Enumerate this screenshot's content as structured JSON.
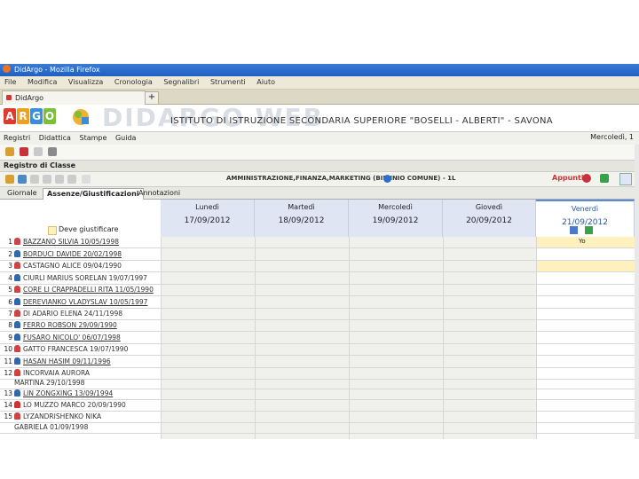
{
  "window": {
    "title": "DidArgo - Mozilla Firefox"
  },
  "menubar": [
    "File",
    "Modifica",
    "Visualizza",
    "Cronologia",
    "Segnalibri",
    "Strumenti",
    "Aiuto"
  ],
  "browser_tab": {
    "label": "DidArgo",
    "new_tab": "+"
  },
  "header": {
    "logo_letters": [
      "A",
      "R",
      "G",
      "O"
    ],
    "logo_colors": [
      "#e03a2f",
      "#f0a020",
      "#3a8fd6",
      "#7bbf3a"
    ],
    "watermark": "DIDARGO WEB",
    "school": "ISTITUTO DI ISTRUZIONE SECONDARIA SUPERIORE \"BOSELLI - ALBERTI\" - SAVONA"
  },
  "main_menu": {
    "items": [
      "Registri",
      "Didattica",
      "Stampe",
      "Guida"
    ],
    "date": "Mercoledì, 1"
  },
  "registro": {
    "title": "Registro di Classe"
  },
  "toolbar2": {
    "class_name": "AMMINISTRAZIONE,FINANZA,MARKETING (BIENNIO COMUNE) - 1L",
    "appunti": "Appunti"
  },
  "tabs": [
    "Giornale",
    "Assenze/Giustificazioni",
    "Annotazioni"
  ],
  "grid": {
    "legend": "Deve giustificare",
    "days": [
      {
        "name": "Lunedì",
        "date": "17/09/2012"
      },
      {
        "name": "Martedì",
        "date": "18/09/2012"
      },
      {
        "name": "Mercoledì",
        "date": "19/09/2012"
      },
      {
        "name": "Giovedì",
        "date": "20/09/2012"
      },
      {
        "name": "Venerdì",
        "date": "21/09/2012"
      }
    ],
    "cell_note": "Yo",
    "students": [
      {
        "n": "1",
        "name": "BAZZANO SILVIA 10/05/1998",
        "color": "#c44"
      },
      {
        "n": "2",
        "name": "BORDUCI DAVIDE 20/02/1998",
        "color": "#36a"
      },
      {
        "n": "3",
        "name": "CASTAGNO ALICE 09/04/1990",
        "color": "#c44"
      },
      {
        "n": "4",
        "name": "CIURLI MARIUS SORELAN 19/07/1997",
        "color": "#36a"
      },
      {
        "n": "5",
        "name": "CORE LI CRAPPADELLI RITA 11/05/1990",
        "color": "#c44"
      },
      {
        "n": "6",
        "name": "DEREVIANKO VLADYSLAV 10/05/1997",
        "color": "#36a"
      },
      {
        "n": "7",
        "name": "DI ADARIO ELENA 24/11/1998",
        "color": "#c44"
      },
      {
        "n": "8",
        "name": "FERRO ROBSON 29/09/1990",
        "color": "#36a"
      },
      {
        "n": "9",
        "name": "FUSARO NICOLO' 06/07/1998",
        "color": "#36a"
      },
      {
        "n": "10",
        "name": "GATTO FRANCESCA 19/07/1990",
        "color": "#c44"
      },
      {
        "n": "11",
        "name": "HASAN HASIM 09/11/1996",
        "color": "#36a"
      },
      {
        "n": "12",
        "name": "INCORVAIA AURORA",
        "color": "#c44"
      },
      {
        "n": "",
        "name": "MARTINA 29/10/1998",
        "color": ""
      },
      {
        "n": "13",
        "name": "LIN ZONGXING 13/09/1994",
        "color": "#36a"
      },
      {
        "n": "14",
        "name": "LO MUZZO MARCO 20/09/1990",
        "color": "#c33"
      },
      {
        "n": "15",
        "name": "LYZANDRISHENKO NIKA",
        "color": "#c44"
      },
      {
        "n": "",
        "name": "GABRIELA 01/09/1998",
        "color": ""
      }
    ]
  }
}
